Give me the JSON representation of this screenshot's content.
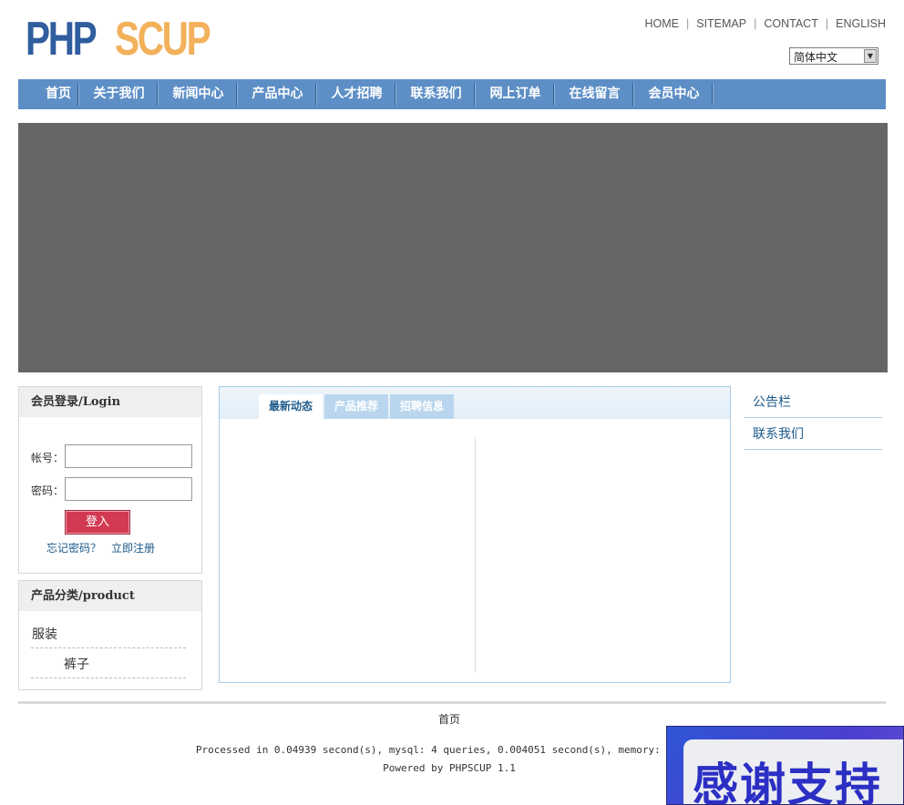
{
  "logo": {
    "part1": "PHP",
    "part2": "SCUP"
  },
  "top_links": [
    "HOME",
    "SITEMAP",
    "CONTACT",
    "ENGLISH"
  ],
  "language_select": {
    "value": "简体中文"
  },
  "nav": [
    "首页",
    "关于我们",
    "新闻中心",
    "产品中心",
    "人才招聘",
    "联系我们",
    "网上订单",
    "在线留言",
    "会员中心"
  ],
  "login": {
    "title": "会员登录/Login",
    "account_label": "帐号：",
    "password_label": "密码：",
    "account_value": "",
    "password_value": "",
    "submit_label": "登入",
    "forgot_label": "忘记密码？",
    "register_label": "立即注册"
  },
  "products": {
    "title": "产品分类/product",
    "categories": [
      {
        "label": "服装",
        "children": [
          "裤子"
        ]
      }
    ]
  },
  "tabs": [
    "最新动态",
    "产品推荐",
    "招聘信息"
  ],
  "sidebar": [
    "公告栏",
    "联系我们"
  ],
  "footer": {
    "home_link": "首页",
    "processed": "Processed in 0.04939 second(s), mysql: 4 queries, 0.004051 second(s), memory: 732.00",
    "powered": "Powered by PHPSCUP 1.1"
  },
  "thanks_badge": "感谢支持",
  "colors": {
    "nav_bg": "#5d8fc6",
    "banner": "#666666",
    "login_button": "#d13a52",
    "link_blue": "#1e5b8c",
    "logo_blue": "#2f5d9e",
    "logo_orange": "#f3b15b"
  }
}
